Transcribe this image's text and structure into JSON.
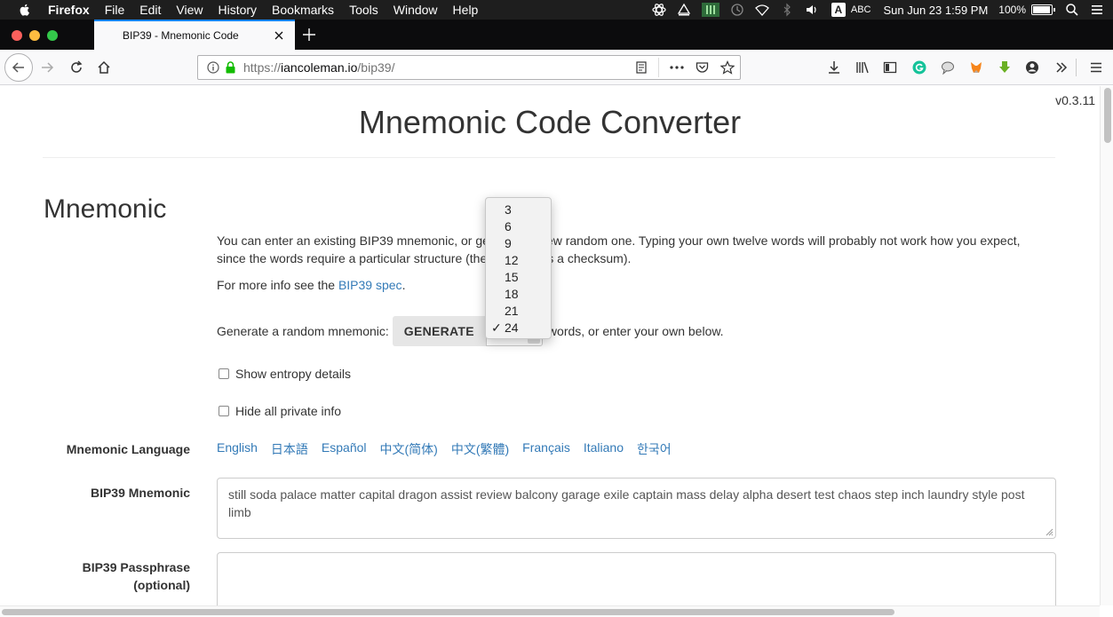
{
  "menubar": {
    "app": "Firefox",
    "items": [
      "File",
      "Edit",
      "View",
      "History",
      "Bookmarks",
      "Tools",
      "Window",
      "Help"
    ],
    "input_source": "ABC",
    "input_badge": "A",
    "datetime": "Sun Jun 23  1:59 PM",
    "battery_pct": "100%",
    "battery_level": 1.0
  },
  "browser": {
    "tab_title": "BIP39 - Mnemonic Code",
    "url_scheme": "https://",
    "url_host": "iancoleman.io",
    "url_path": "/bip39/",
    "colors": {
      "accent": "#0a84ff",
      "link": "#337ab7"
    }
  },
  "page": {
    "version": "v0.3.11",
    "title": "Mnemonic Code Converter",
    "section_title": "Mnemonic",
    "intro_line1": "You can enter an existing BIP39 mnemonic, or ge",
    "intro_line1_tail": "ew random one. Typing your own twelve words will probably not work how you expect,",
    "intro_line2": "since the words require a particular structure (the",
    "intro_line2_tail": "s a checksum).",
    "more_info_prefix": "For more info see the ",
    "more_info_link": "BIP39 spec",
    "more_info_suffix": ".",
    "generate_prefix": "Generate a random mnemonic:",
    "generate_button": "GENERATE",
    "generate_suffix": "words, or enter your own below.",
    "show_entropy": "Show entropy details",
    "hide_private": "Hide all private info",
    "language_label": "Mnemonic Language",
    "languages": [
      "English",
      "日本語",
      "Español",
      "中文(简体)",
      "中文(繁體)",
      "Français",
      "Italiano",
      "한국어"
    ],
    "mnemonic_label": "BIP39 Mnemonic",
    "mnemonic_value": "still soda palace matter capital dragon assist review balcony garage exile captain mass delay alpha desert test chaos step inch laundry style post limb",
    "passphrase_label_1": "BIP39 Passphrase",
    "passphrase_label_2": "(optional)",
    "passphrase_value": ""
  },
  "word_count_dropdown": {
    "options": [
      "3",
      "6",
      "9",
      "12",
      "15",
      "18",
      "21",
      "24"
    ],
    "selected": "24",
    "check": "✓"
  }
}
